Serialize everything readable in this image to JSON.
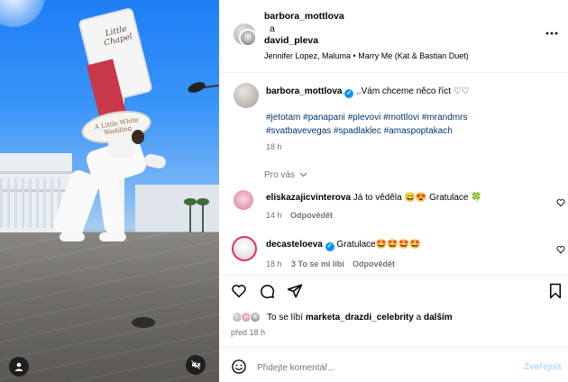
{
  "post_header": {
    "author": "barbora_mottlova",
    "connector": "a",
    "coauthor": "david_pleva",
    "audio": "Jennifer Lopez, Maluma • Marry Me (Kat & Bastian Duet)"
  },
  "caption": {
    "author": "barbora_mottlova",
    "text": "..Vám chceme něco říct ♡♡",
    "hashtags_line1": "#jetotam #panapani #plevovi #mottlovi #mrandmrs",
    "hashtags_line2": "#svatbavevegas #spadlaklec #amaspoptakach",
    "time": "18 h"
  },
  "for_you_label": "Pro vás",
  "comments": [
    {
      "user": "eliskazajicvinterova",
      "text": "Já to věděla 😄😍 Gratulace 🍀",
      "time": "14 h",
      "reply": "Odpovědět",
      "likes": ""
    },
    {
      "user": "decasteloeva",
      "text": "Gratulace🤩🤩🤩🤩",
      "time": "18 h",
      "likes": "3 To se mi líbí",
      "reply": "Odpovědět"
    }
  ],
  "likes": {
    "prefix": "To se líbí",
    "user": "marketa_drazdi_celebrity",
    "middle": "a",
    "suffix": "dalším"
  },
  "post_time": "před 18 h",
  "comment_box": {
    "placeholder": "Přidejte komentář...",
    "submit": "Zveřejnit"
  },
  "media": {
    "tower_sign_text": "Little Chapel",
    "oval_sign_text": "A Little White Wedding"
  },
  "colors": {
    "link": "#00376b",
    "verified": "#0095f6",
    "muted": "#737373",
    "submit_disabled": "#b3dbff"
  },
  "icons": [
    "more-icon",
    "heart-icon",
    "comment-icon",
    "share-icon",
    "bookmark-icon",
    "emoji-icon",
    "user-tag-icon",
    "mute-icon",
    "chevron-down-icon"
  ]
}
